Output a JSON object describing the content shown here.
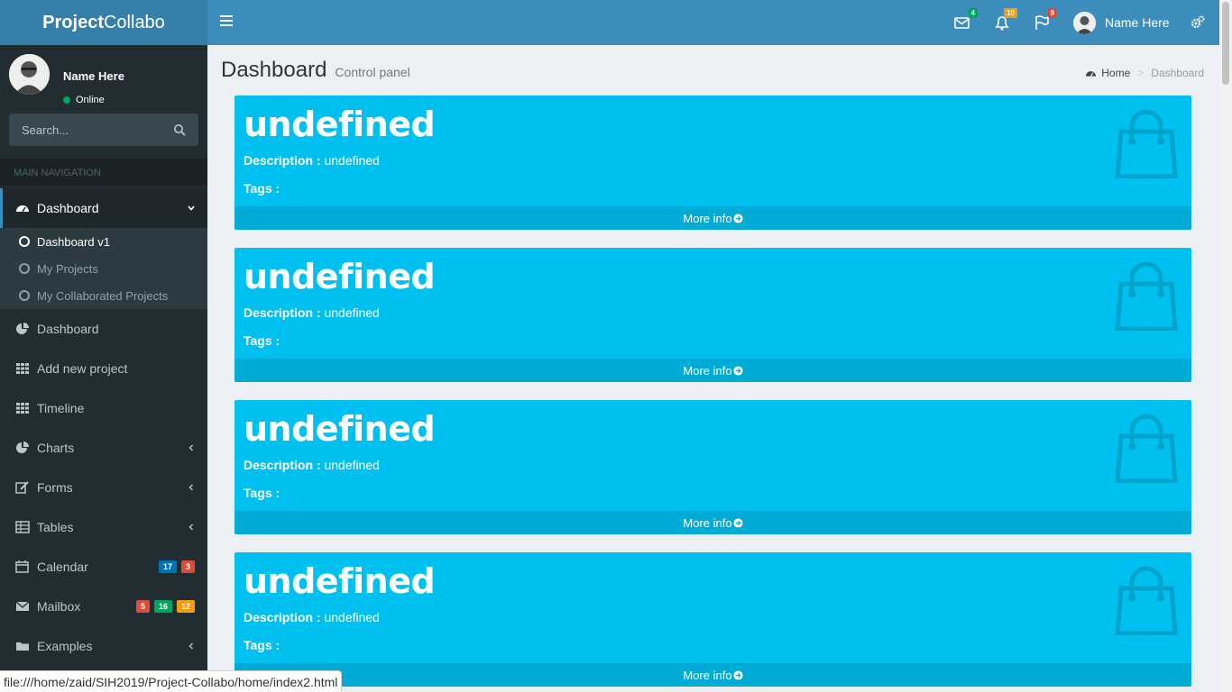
{
  "brand": {
    "bold": "Project",
    "rest": "Collabo"
  },
  "navbar": {
    "messages_count": "4",
    "notifications_count": "10",
    "tasks_count": "9",
    "user_name": "Name Here"
  },
  "sidebar": {
    "user_name": "Name Here",
    "status": "Online",
    "search_placeholder": "Search...",
    "header": "MAIN NAVIGATION",
    "items": [
      {
        "label": "Dashboard"
      },
      {
        "label": "Dashboard"
      },
      {
        "label": "Add new project"
      },
      {
        "label": "Timeline"
      },
      {
        "label": "Charts"
      },
      {
        "label": "Forms"
      },
      {
        "label": "Tables"
      },
      {
        "label": "Calendar",
        "badges": [
          "17",
          "3"
        ]
      },
      {
        "label": "Mailbox",
        "badges": [
          "5",
          "16",
          "12"
        ]
      },
      {
        "label": "Examples"
      }
    ],
    "submenu": [
      "Dashboard v1",
      "My Projects",
      "My Collaborated Projects"
    ]
  },
  "content": {
    "title": "Dashboard",
    "subtitle": "Control panel",
    "breadcrumb": {
      "home": "Home",
      "current": "Dashboard"
    }
  },
  "cards": [
    {
      "title": "undefined",
      "desc_label": "Description :",
      "desc_value": "undefined",
      "tags_label": "Tags :",
      "footer": "More info"
    },
    {
      "title": "undefined",
      "desc_label": "Description :",
      "desc_value": "undefined",
      "tags_label": "Tags :",
      "footer": "More info"
    },
    {
      "title": "undefined",
      "desc_label": "Description :",
      "desc_value": "undefined",
      "tags_label": "Tags :",
      "footer": "More info"
    },
    {
      "title": "undefined",
      "desc_label": "Description :",
      "desc_value": "undefined",
      "tags_label": "Tags :",
      "footer": "More info"
    }
  ],
  "status_bar": "file:///home/zaid/SIH2019/Project-Collabo/home/index2.html",
  "colors": {
    "navbar": "#3c8dbc",
    "logo_bg": "#367fa9",
    "sidebar": "#222d32",
    "card": "#00c0ef",
    "badge_blue": "#0073b7",
    "badge_red": "#dd4b39",
    "badge_green": "#00a65a",
    "badge_yellow": "#f39c12"
  }
}
